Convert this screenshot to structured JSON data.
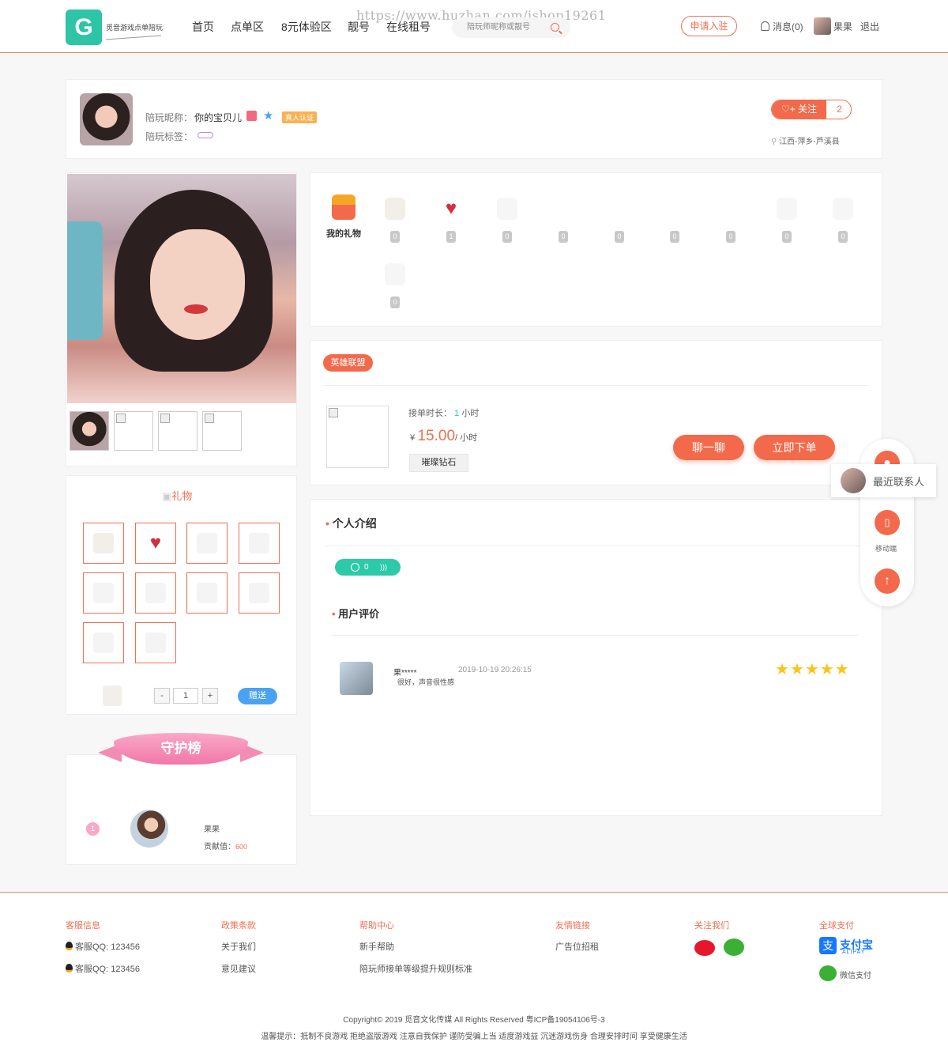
{
  "header": {
    "logo_text": "觅音游戏点单陪玩",
    "logo_glyph": "G",
    "watermark": "https://www.huzhan.com/ishop19261",
    "nav": [
      "首页",
      "点单区",
      "8元体验区",
      "靓号",
      "在线租号"
    ],
    "search_placeholder": "陪玩师昵称或靓号",
    "apply_label": "申请入驻",
    "messages_label": "消息(0)",
    "username": "果果",
    "logout_label": "退出"
  },
  "profile": {
    "nickname_label": "陪玩昵称：",
    "nickname": "你的宝贝儿",
    "tags_label": "陪玩标签：",
    "real_badge": "真人认证",
    "follow_label": "关注",
    "follow_count": "2",
    "location": "江西-萍乡-芦溪县"
  },
  "gifts_received": {
    "title": "我的礼物",
    "counts": [
      "0",
      "1",
      "0",
      "0",
      "0",
      "0",
      "0",
      "0",
      "0",
      "0"
    ]
  },
  "service": {
    "game": "英雄联盟",
    "duration_label": "接单时长：",
    "duration_value": "1",
    "duration_unit": "小时",
    "currency": "¥",
    "price": "15.00",
    "price_unit": "/ 小时",
    "rank": "璀璨钻石",
    "chat_button": "聊一聊",
    "order_button": "立即下单"
  },
  "intro": {
    "title": "个人介绍",
    "voice_count": "0"
  },
  "reviews": {
    "title": "用户评价",
    "items": [
      {
        "user": "果*****",
        "time": "2019-10-19 20:26:15",
        "text": "很好，声音很性感",
        "stars": 5
      }
    ]
  },
  "gift_panel": {
    "title": "礼物",
    "quantity": "1",
    "minus": "-",
    "plus": "+",
    "give_label": "赠送"
  },
  "guard": {
    "title": "守护榜",
    "entries": [
      {
        "rank": "1",
        "name": "果果",
        "contrib_label": "贡献值：",
        "contrib_value": "600"
      }
    ]
  },
  "float": {
    "recent_label": "最近联系人",
    "mobile_label": "移动端"
  },
  "footer": {
    "cols": [
      {
        "title": "客服信息",
        "items": [
          "客服QQ: 123456",
          "客服QQ: 123456"
        ]
      },
      {
        "title": "政策条款",
        "items": [
          "关于我们",
          "意见建议"
        ]
      },
      {
        "title": "帮助中心",
        "items": [
          "新手帮助",
          "陪玩师接单等级提升规则标准"
        ]
      },
      {
        "title": "友情链接",
        "items": [
          "广告位招租"
        ]
      },
      {
        "title": "关注我们",
        "items": []
      },
      {
        "title": "全球支付",
        "items": [
          "支付宝",
          "ALIPAY",
          "微信支付"
        ]
      }
    ],
    "copyright": "Copyright© 2019 觅音文化传媒 All Rights Reserved 粤ICP备19054106号-3",
    "notice": "温馨提示：抵制不良游戏 拒绝盗版游戏 注意自我保护 谨防受骗上当 适度游戏益 沉迷游戏伤身 合理安排时间 享受健康生活"
  },
  "colors": {
    "accent": "#f26a4b",
    "teal": "#2ccaa9",
    "blue": "#4aa3f0",
    "pink": "#f178a8"
  }
}
